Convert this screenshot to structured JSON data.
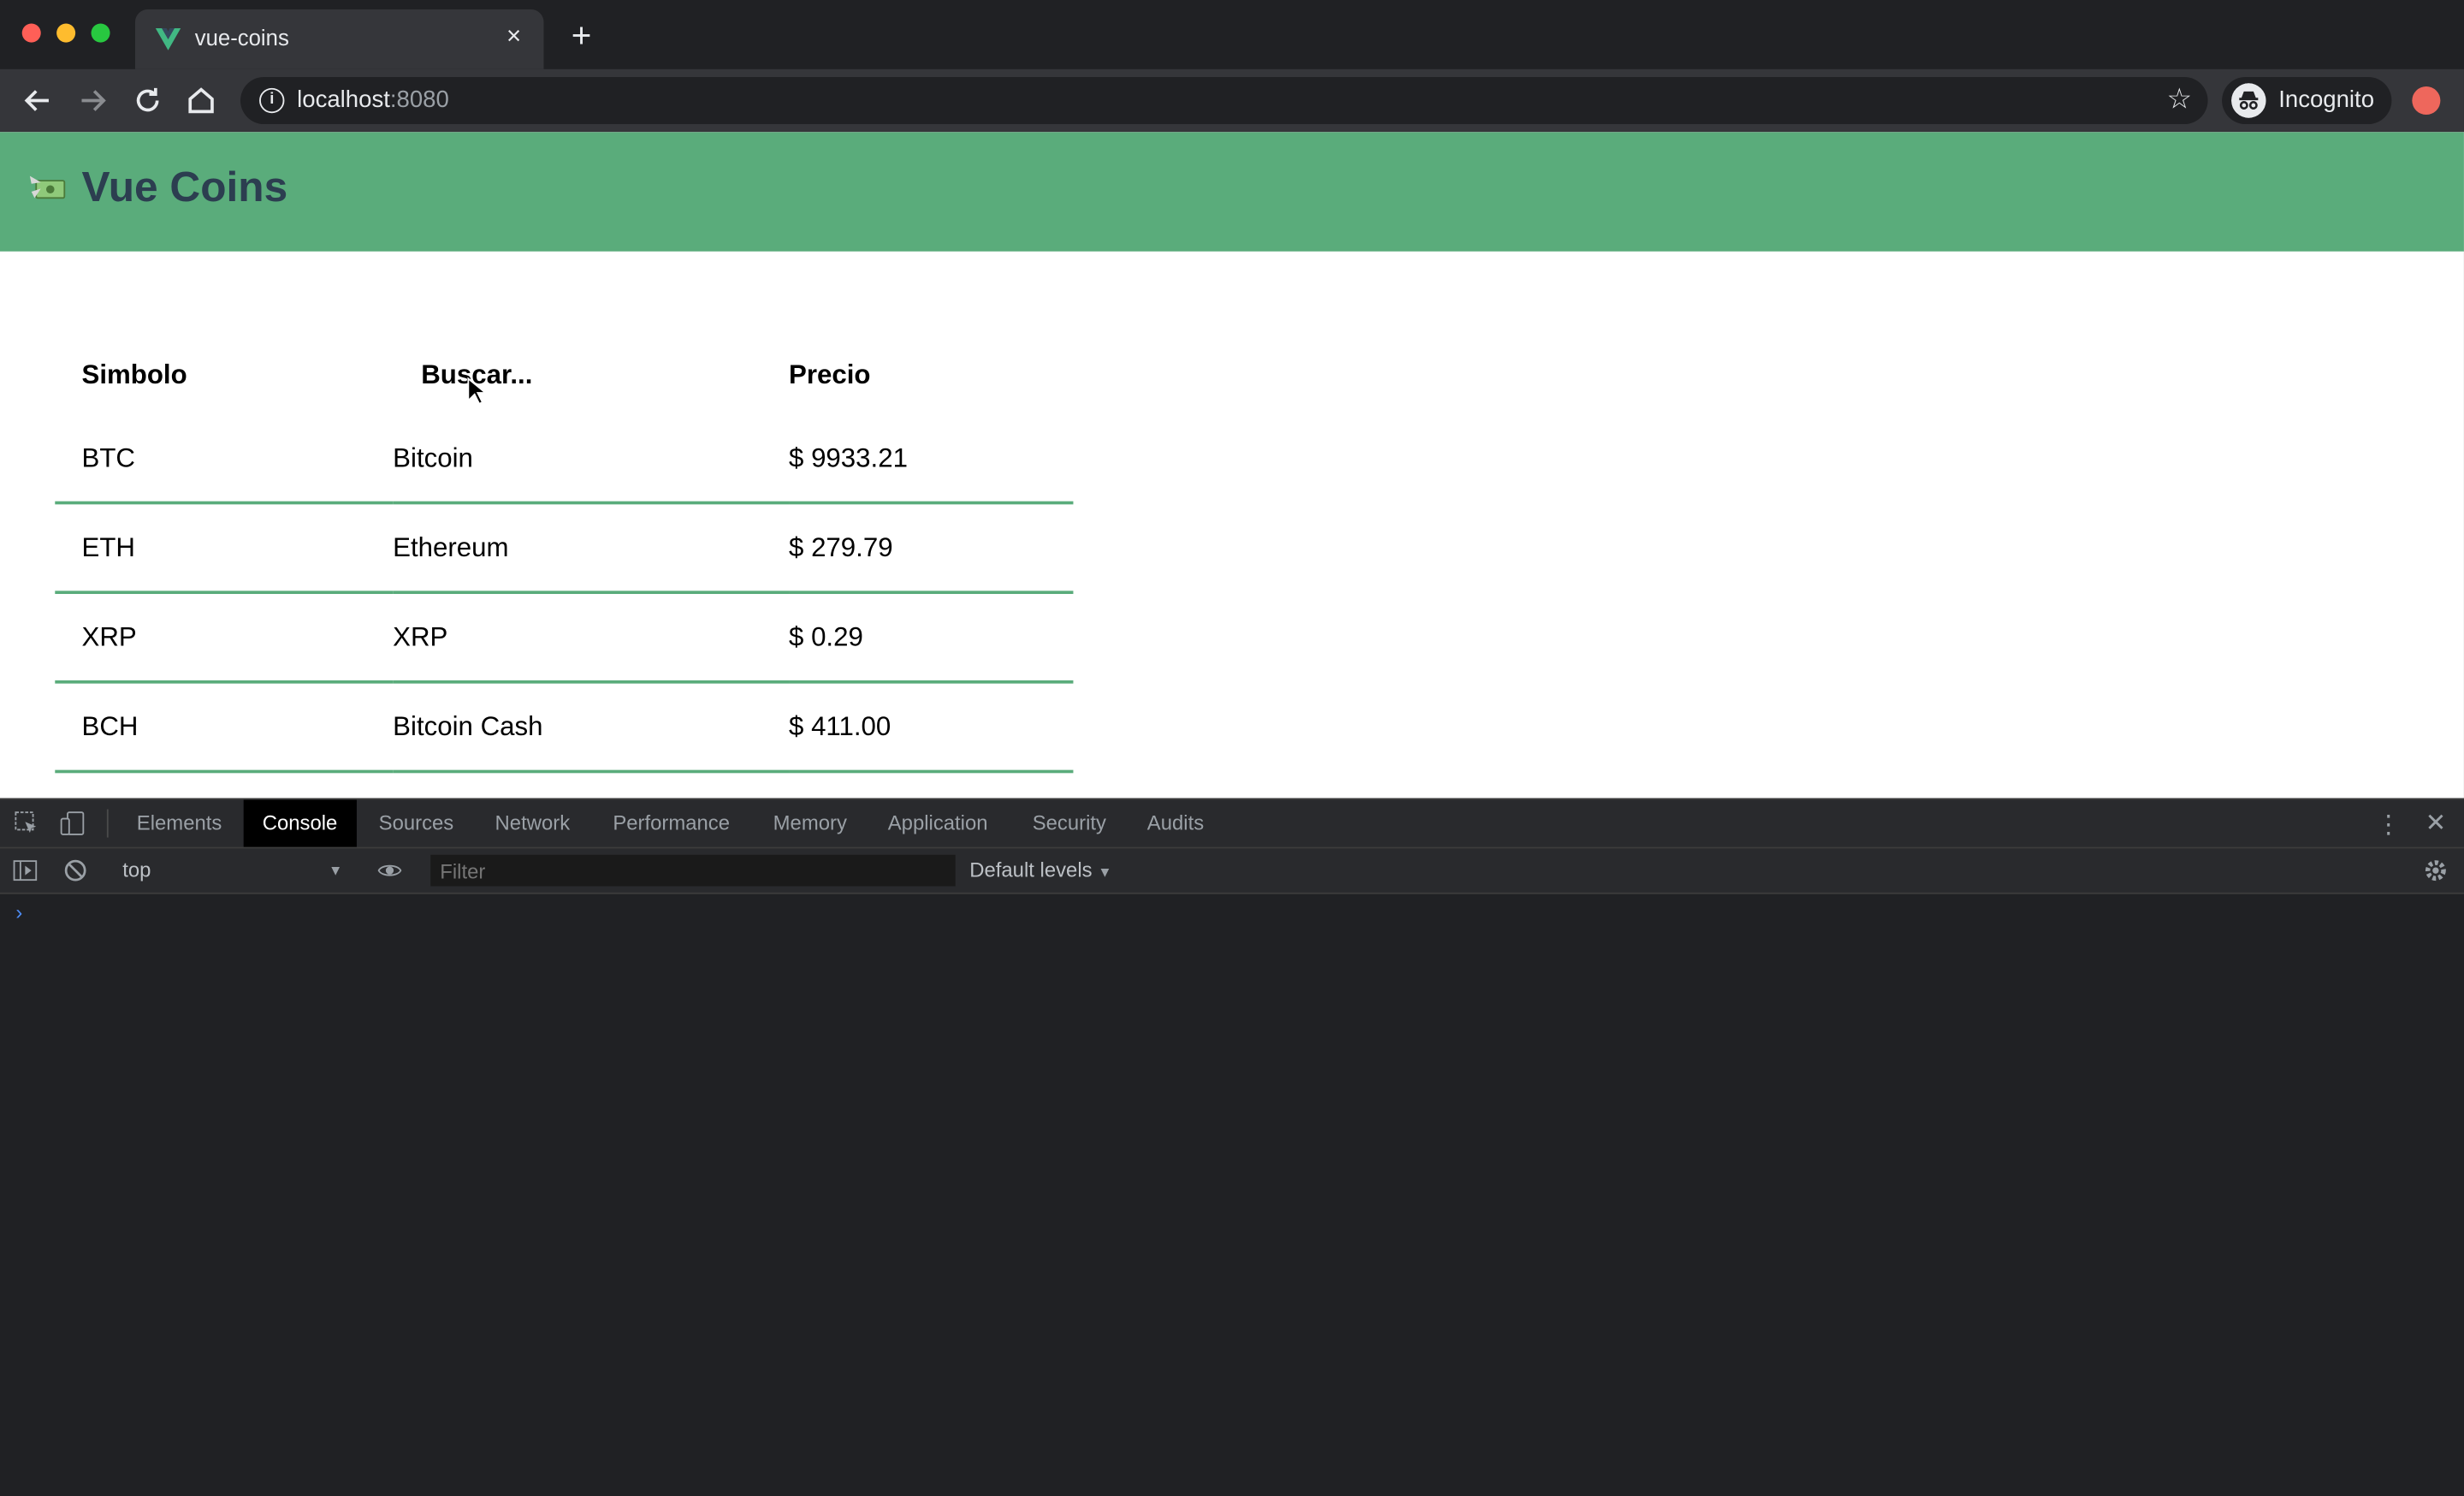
{
  "browser": {
    "tab": {
      "title": "vue-coins",
      "close_icon": "×"
    },
    "new_tab_icon": "+",
    "address": {
      "host": "localhost",
      "port": ":8080"
    },
    "profile_label": "Incognito"
  },
  "app": {
    "title": "Vue Coins",
    "logo_icon": "money-with-wings-icon",
    "header_color": "#5aac7b",
    "table": {
      "headers": {
        "symbol": "Simbolo",
        "search_placeholder": "Buscar...",
        "price": "Precio"
      },
      "rows": [
        {
          "symbol": "BTC",
          "name": "Bitcoin",
          "price": "$ 9933.21"
        },
        {
          "symbol": "ETH",
          "name": "Ethereum",
          "price": "$ 279.79"
        },
        {
          "symbol": "XRP",
          "name": "XRP",
          "price": "$ 0.29"
        },
        {
          "symbol": "BCH",
          "name": "Bitcoin Cash",
          "price": "$ 411.00"
        }
      ]
    }
  },
  "devtools": {
    "tabs": [
      "Elements",
      "Console",
      "Sources",
      "Network",
      "Performance",
      "Memory",
      "Application",
      "Security",
      "Audits"
    ],
    "active_tab": "Console",
    "context": "top",
    "filter_placeholder": "Filter",
    "levels": "Default levels",
    "prompt": "›"
  }
}
